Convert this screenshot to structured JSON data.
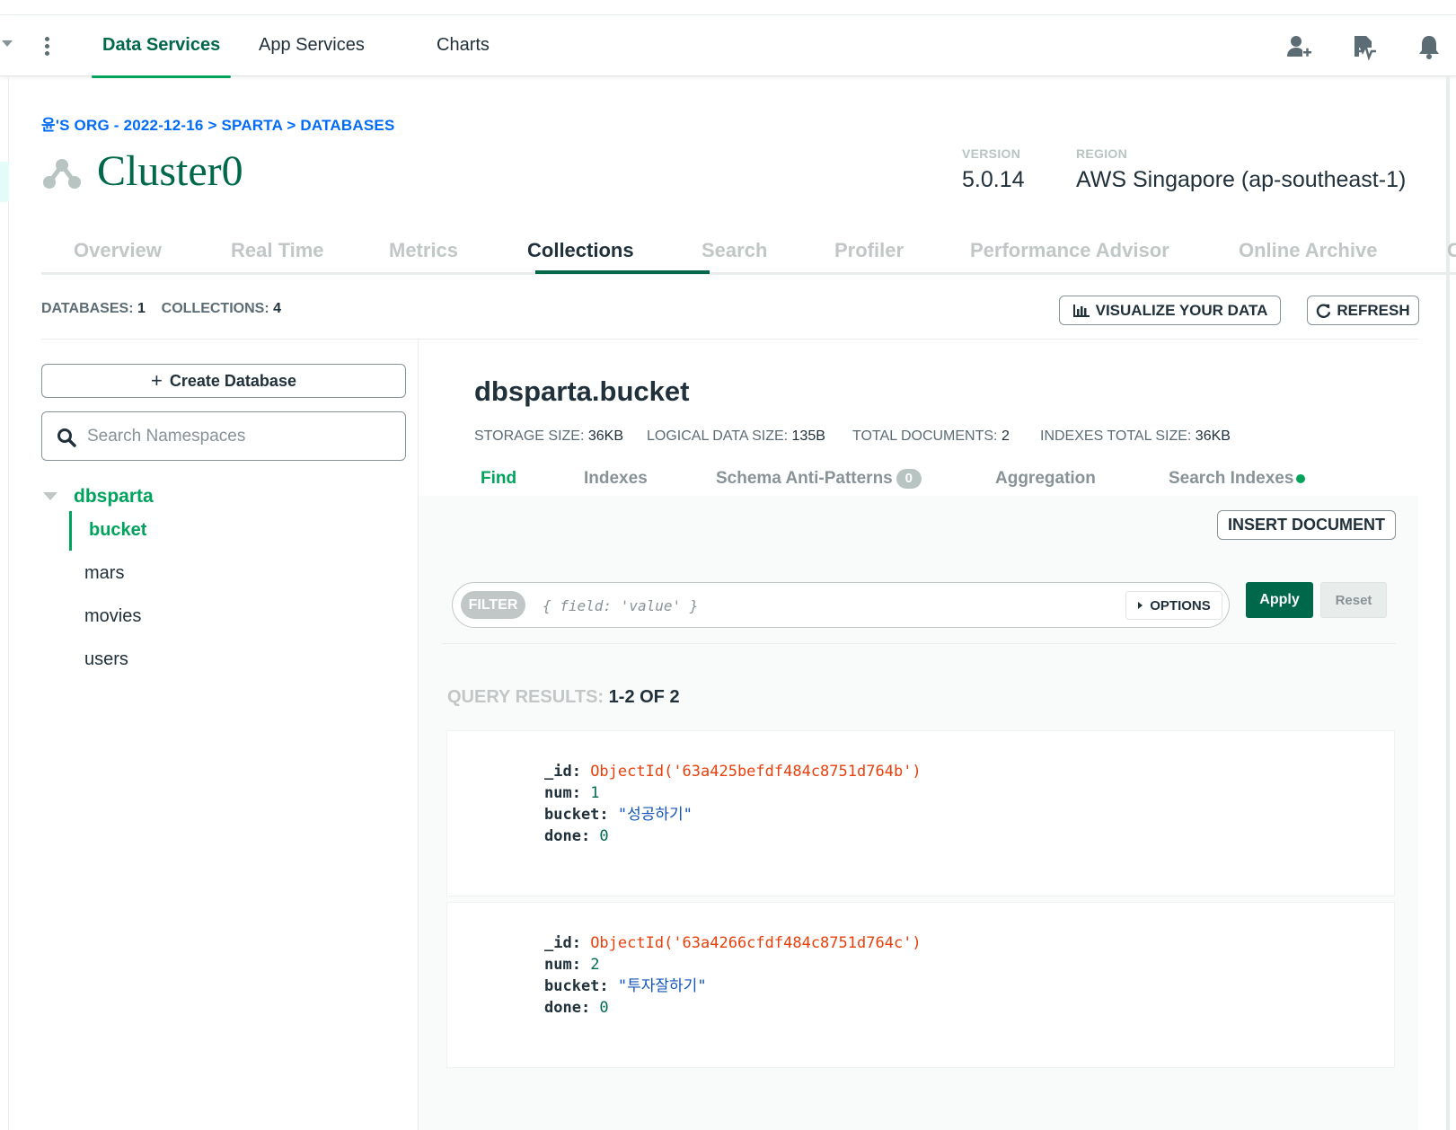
{
  "topnav": {
    "tabs": [
      {
        "label": "Data Services",
        "active": true
      },
      {
        "label": "App Services",
        "active": false
      },
      {
        "label": "Charts",
        "active": false
      }
    ],
    "icons": [
      "invite-user-icon",
      "activity-feed-icon",
      "notifications-bell-icon"
    ]
  },
  "breadcrumb": "윤'S ORG - 2022-12-16 > SPARTA > DATABASES",
  "cluster": {
    "name": "Cluster0",
    "version_label": "VERSION",
    "version": "5.0.14",
    "region_label": "REGION",
    "region": "AWS Singapore (ap-southeast-1)"
  },
  "tabs": {
    "items": [
      "Overview",
      "Real Time",
      "Metrics",
      "Collections",
      "Search",
      "Profiler",
      "Performance Advisor",
      "Online Archive",
      "C"
    ],
    "active": "Collections"
  },
  "counts": {
    "databases_label": "DATABASES:",
    "databases": "1",
    "collections_label": "COLLECTIONS:",
    "collections": "4"
  },
  "actions": {
    "visualize": "VISUALIZE YOUR DATA",
    "refresh": "REFRESH"
  },
  "sidebar": {
    "create_db": "Create Database",
    "search_placeholder": "Search Namespaces",
    "database": "dbsparta",
    "collections": [
      "bucket",
      "mars",
      "movies",
      "users"
    ],
    "active_collection": "bucket"
  },
  "collection": {
    "title": "dbsparta.bucket",
    "stats": {
      "storage_label": "STORAGE SIZE:",
      "storage": "36KB",
      "logical_label": "LOGICAL DATA SIZE:",
      "logical": "135B",
      "docs_label": "TOTAL DOCUMENTS:",
      "docs": "2",
      "indexes_label": "INDEXES TOTAL SIZE:",
      "indexes": "36KB"
    },
    "subtabs": {
      "find": "Find",
      "indexes": "Indexes",
      "schema": "Schema Anti-Patterns",
      "schema_count": "0",
      "aggregation": "Aggregation",
      "search_indexes": "Search Indexes"
    },
    "insert_document": "INSERT DOCUMENT",
    "filter": {
      "pill": "FILTER",
      "placeholder": "{ field: 'value' }",
      "options": "OPTIONS",
      "apply": "Apply",
      "reset": "Reset"
    },
    "results_label": "QUERY RESULTS:",
    "results_range": "1-2 OF 2",
    "documents": [
      {
        "_id": "ObjectId('63a425befdf484c8751d764b')",
        "num": "1",
        "bucket": "\"성공하기\"",
        "done": "0"
      },
      {
        "_id": "ObjectId('63a4266cfdf484c8751d764c')",
        "num": "2",
        "bucket": "\"투자잘하기\"",
        "done": "0"
      }
    ]
  }
}
